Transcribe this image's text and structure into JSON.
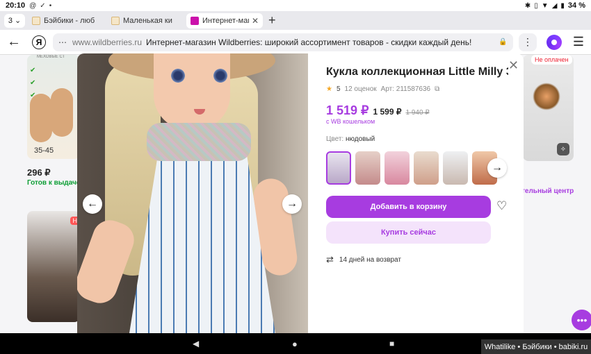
{
  "status": {
    "time": "20:10",
    "battery": "34 %",
    "icons": [
      "at-icon",
      "check-circle-icon",
      "dot-icon",
      "bluetooth-icon",
      "vibrate-icon",
      "wifi-icon",
      "signal-icon",
      "battery-icon"
    ]
  },
  "tabs": {
    "count": "3",
    "items": [
      {
        "label": "Бэйбики - люб",
        "active": false
      },
      {
        "label": "Маленькая ки",
        "active": false
      },
      {
        "label": "Интернет-маг",
        "active": true
      }
    ]
  },
  "address": {
    "domain": "www.wildberries.ru",
    "title": "Интернет-магазин Wildberries: широкий ассортимент товаров - скидки каждый день!"
  },
  "background": {
    "card1_price": "296 ₽",
    "card1_status": "Готов к выдаче",
    "card1_size": "35-45",
    "card1_header": "МЕХОВЫЕ СТ",
    "card2_badge": "Н",
    "card3_badge": "Не оплачен",
    "pickup_text": "тельный центр"
  },
  "product": {
    "title": "Кукла коллекционная Little Milly 3...",
    "rating": "5",
    "reviews": "12 оценок",
    "article": "Арт: 211587636",
    "price_main": "1 519 ₽",
    "price_second": "1 599 ₽",
    "price_old": "1 940 ₽",
    "wallet_note": "с WB кошельком",
    "color_label": "Цвет:",
    "color_value": "нюдовый",
    "add_to_cart": "Добавить в корзину",
    "buy_now": "Купить сейчас",
    "returns": "14 дней на возврат"
  },
  "watermark": "Whatilike • Бэйбики • babiki.ru",
  "colors": {
    "accent": "#a73ce0",
    "accent_light": "#f4e3fb",
    "ready_green": "#0a9d33"
  }
}
